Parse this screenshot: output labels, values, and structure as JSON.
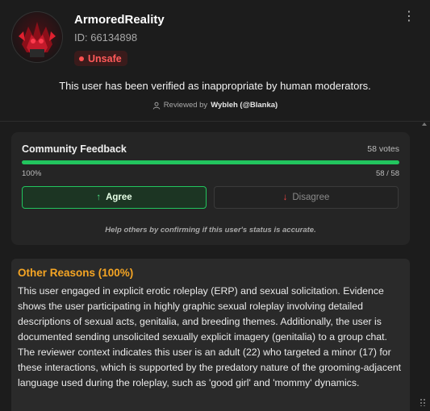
{
  "profile": {
    "username": "ArmoredReality",
    "id_text": "ID: 66134898",
    "status_badge": "Unsafe",
    "verified_text": "This user has been verified as inappropriate by human moderators.",
    "reviewed_prefix": "Reviewed by",
    "reviewer": "Wybleh (@Blanka)"
  },
  "community": {
    "title": "Community Feedback",
    "votes": "58 votes",
    "progress_percent": 100,
    "percent_label": "100%",
    "ratio_label": "58 / 58",
    "agree_label": "Agree",
    "disagree_label": "Disagree",
    "help_text": "Help others by confirming if this user's status is accurate."
  },
  "reasons": {
    "title": "Other Reasons (100%)",
    "body": "This user engaged in explicit erotic roleplay (ERP) and sexual solicitation. Evidence shows the user participating in highly graphic sexual roleplay involving detailed descriptions of sexual acts, genitalia, and breeding themes. Additionally, the user is documented sending unsolicited sexually explicit imagery (genitalia) to a group chat. The reviewer context indicates this user is an adult (22) who targeted a minor (17) for these interactions, which is supported by the predatory nature of the grooming-adjacent language used during the roleplay, such as 'good girl' and 'mommy' dynamics."
  },
  "colors": {
    "accent_green": "#22c55e",
    "danger_red": "#ff5a5a",
    "reasons_title": "#f5a524"
  },
  "icons": [
    "more-vertical-icon",
    "status-dot-icon",
    "user-icon",
    "arrow-up-icon",
    "arrow-down-icon",
    "resize-grip-icon"
  ]
}
